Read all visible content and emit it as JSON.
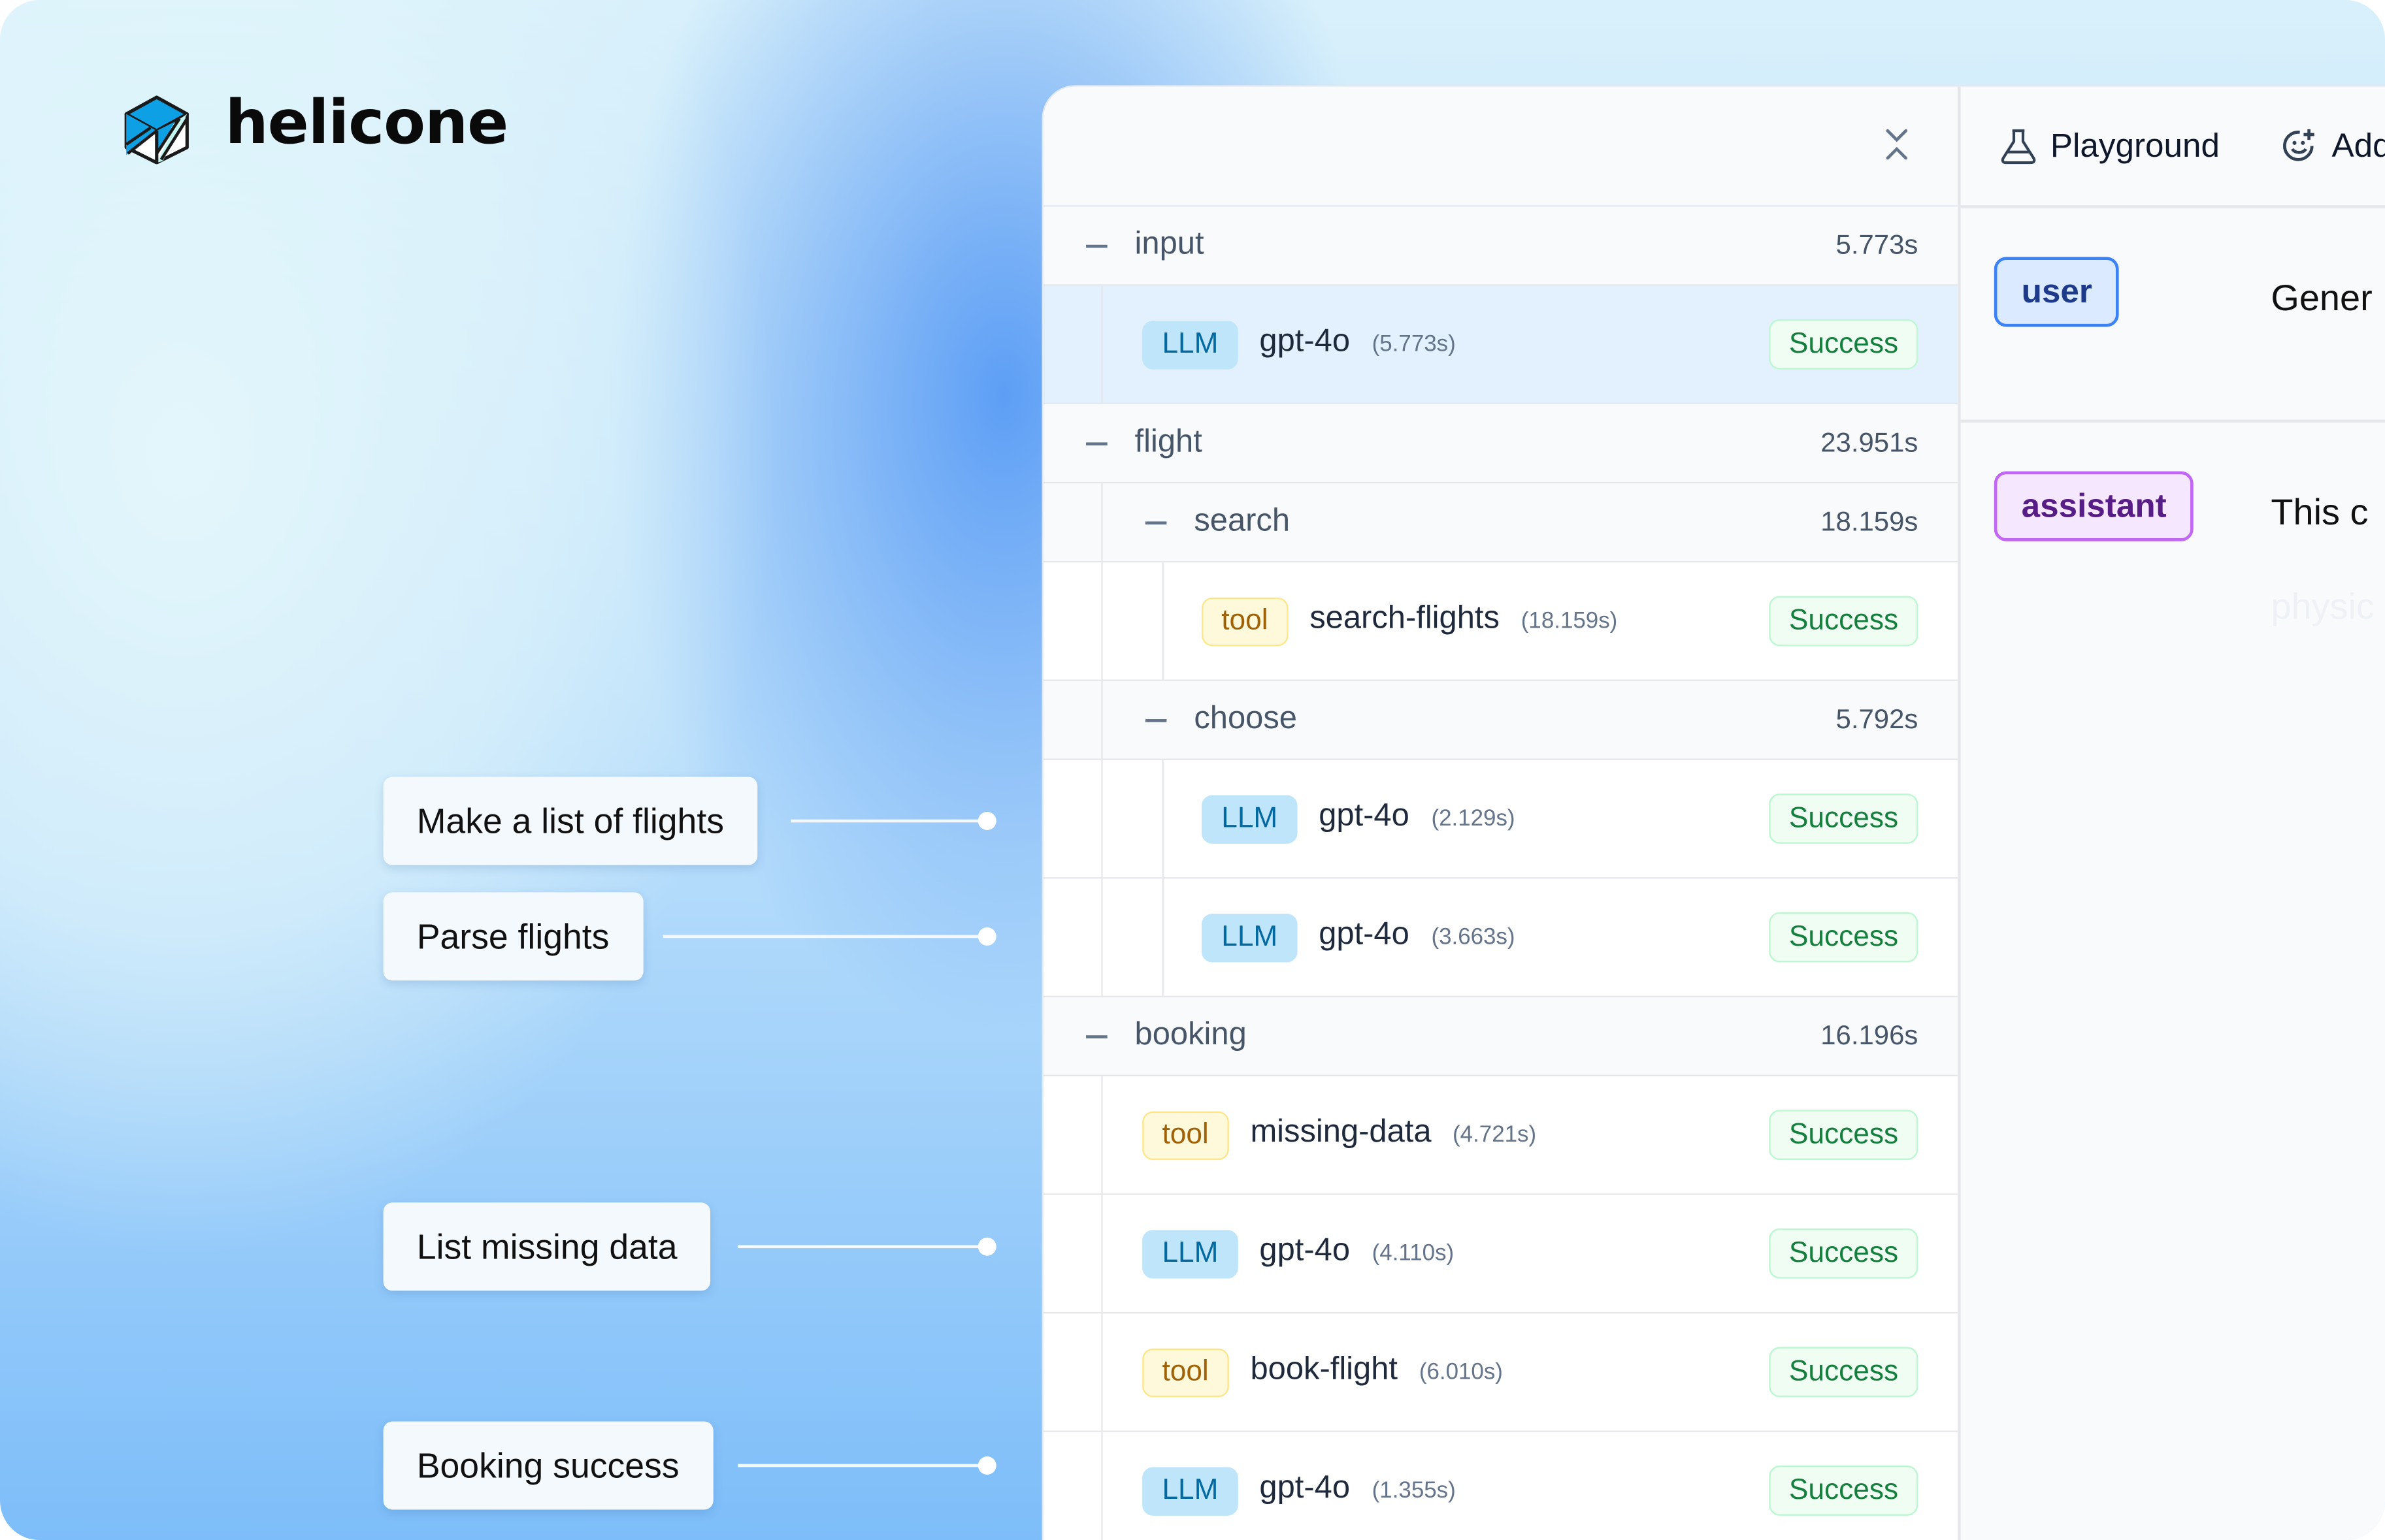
{
  "brand": {
    "name": "helicone",
    "logo_icon": "helicone-cube-logo"
  },
  "callouts": [
    {
      "label": "Make a list of flights"
    },
    {
      "label": "Parse flights"
    },
    {
      "label": "List missing data"
    },
    {
      "label": "Booking success"
    }
  ],
  "tree": {
    "close_icon": "close-icon",
    "rows": [
      {
        "kind": "group",
        "depth": 0,
        "label": "input",
        "time": "5.773s"
      },
      {
        "kind": "item",
        "depth": 1,
        "type": "LLM",
        "name": "gpt-4o",
        "time": "(5.773s)",
        "status": "Success",
        "selected": true
      },
      {
        "kind": "group",
        "depth": 0,
        "label": "flight",
        "time": "23.951s"
      },
      {
        "kind": "group",
        "depth": 1,
        "label": "search",
        "time": "18.159s"
      },
      {
        "kind": "item",
        "depth": 2,
        "type": "tool",
        "name": "search-flights",
        "time": "(18.159s)",
        "status": "Success"
      },
      {
        "kind": "group",
        "depth": 1,
        "label": "choose",
        "time": "5.792s"
      },
      {
        "kind": "item",
        "depth": 2,
        "type": "LLM",
        "name": "gpt-4o",
        "time": "(2.129s)",
        "status": "Success"
      },
      {
        "kind": "item",
        "depth": 2,
        "type": "LLM",
        "name": "gpt-4o",
        "time": "(3.663s)",
        "status": "Success"
      },
      {
        "kind": "group",
        "depth": 0,
        "label": "booking",
        "time": "16.196s"
      },
      {
        "kind": "item",
        "depth": 1,
        "type": "tool",
        "name": "missing-data",
        "time": "(4.721s)",
        "status": "Success"
      },
      {
        "kind": "item",
        "depth": 1,
        "type": "LLM",
        "name": "gpt-4o",
        "time": "(4.110s)",
        "status": "Success"
      },
      {
        "kind": "item",
        "depth": 1,
        "type": "tool",
        "name": "book-flight",
        "time": "(6.010s)",
        "status": "Success"
      },
      {
        "kind": "item",
        "depth": 1,
        "type": "LLM",
        "name": "gpt-4o",
        "time": "(1.355s)",
        "status": "Success"
      }
    ]
  },
  "detail": {
    "playground_label": "Playground",
    "add_label": "Add",
    "messages": [
      {
        "role": "user",
        "text": "Gener"
      },
      {
        "role": "assistant",
        "text": "This c",
        "faded_text": "physic"
      }
    ]
  }
}
